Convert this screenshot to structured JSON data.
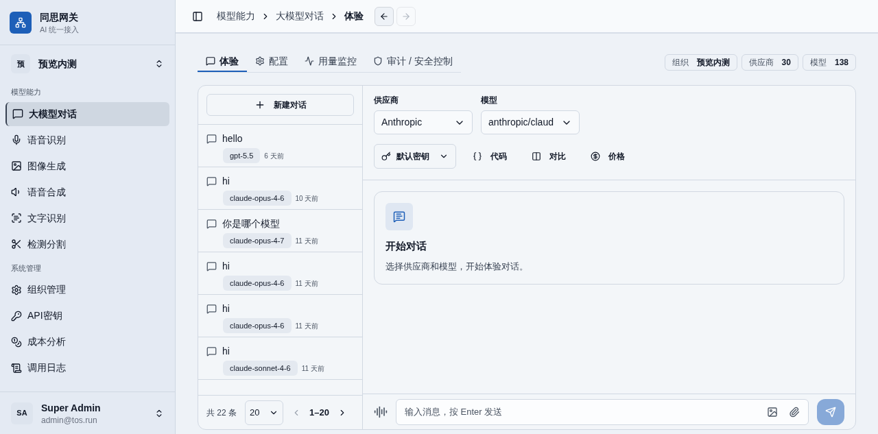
{
  "brand": {
    "title": "同思网关",
    "subtitle": "AI 统一接入"
  },
  "workspace": {
    "badge": "预",
    "name": "预览内测"
  },
  "sidebar": {
    "sections": [
      {
        "heading": "模型能力",
        "items": [
          {
            "label": "大模型对话",
            "selected": true
          },
          {
            "label": "语音识别",
            "selected": false
          },
          {
            "label": "图像生成",
            "selected": false
          },
          {
            "label": "语音合成",
            "selected": false
          },
          {
            "label": "文字识别",
            "selected": false
          },
          {
            "label": "检测分割",
            "selected": false
          }
        ]
      },
      {
        "heading": "系统管理",
        "items": [
          {
            "label": "组织管理",
            "selected": false
          },
          {
            "label": "API密钥",
            "selected": false
          },
          {
            "label": "成本分析",
            "selected": false
          },
          {
            "label": "调用日志",
            "selected": false
          }
        ]
      }
    ]
  },
  "user": {
    "initials": "SA",
    "name": "Super Admin",
    "email": "admin@tos.run"
  },
  "breadcrumb": [
    "模型能力",
    "大模型对话",
    "体验"
  ],
  "history_nav": {
    "back_disabled": false,
    "forward_disabled": true
  },
  "tabs": [
    {
      "label": "体验",
      "selected": true
    },
    {
      "label": "配置",
      "selected": false
    },
    {
      "label": "用量监控",
      "selected": false
    },
    {
      "label": "审计 / 安全控制",
      "selected": false
    }
  ],
  "stats": [
    {
      "label": "组织",
      "value": "预览内测"
    },
    {
      "label": "供应商",
      "value": "30"
    },
    {
      "label": "模型",
      "value": "138"
    }
  ],
  "new_chat": "新建对话",
  "conversations": [
    {
      "title": "hello",
      "model": "gpt-5.5",
      "time": "6 天前"
    },
    {
      "title": "hi",
      "model": "claude-opus-4-6",
      "time": "10 天前"
    },
    {
      "title": "你是哪个模型",
      "model": "claude-opus-4-7",
      "time": "11 天前"
    },
    {
      "title": "hi",
      "model": "claude-opus-4-6",
      "time": "11 天前"
    },
    {
      "title": "hi",
      "model": "claude-opus-4-6",
      "time": "11 天前"
    },
    {
      "title": "hi",
      "model": "claude-sonnet-4-6",
      "time": "11 天前"
    }
  ],
  "pagination": {
    "total": "共 22 条",
    "page_size": "20",
    "range": "1–20"
  },
  "provider": {
    "label": "供应商",
    "value": "Anthropic"
  },
  "model": {
    "label": "模型",
    "value": "anthropic/claud"
  },
  "tools": [
    {
      "kind": "select",
      "label": "默认密钥"
    },
    {
      "kind": "button",
      "label": "代码"
    },
    {
      "kind": "button",
      "label": "对比"
    },
    {
      "kind": "button",
      "label": "价格"
    }
  ],
  "empty_state": {
    "title": "开始对话",
    "text": "选择供应商和模型，开始体验对话。"
  },
  "composer": {
    "placeholder": "输入消息，按 Enter 发送",
    "send_disabled": true
  }
}
